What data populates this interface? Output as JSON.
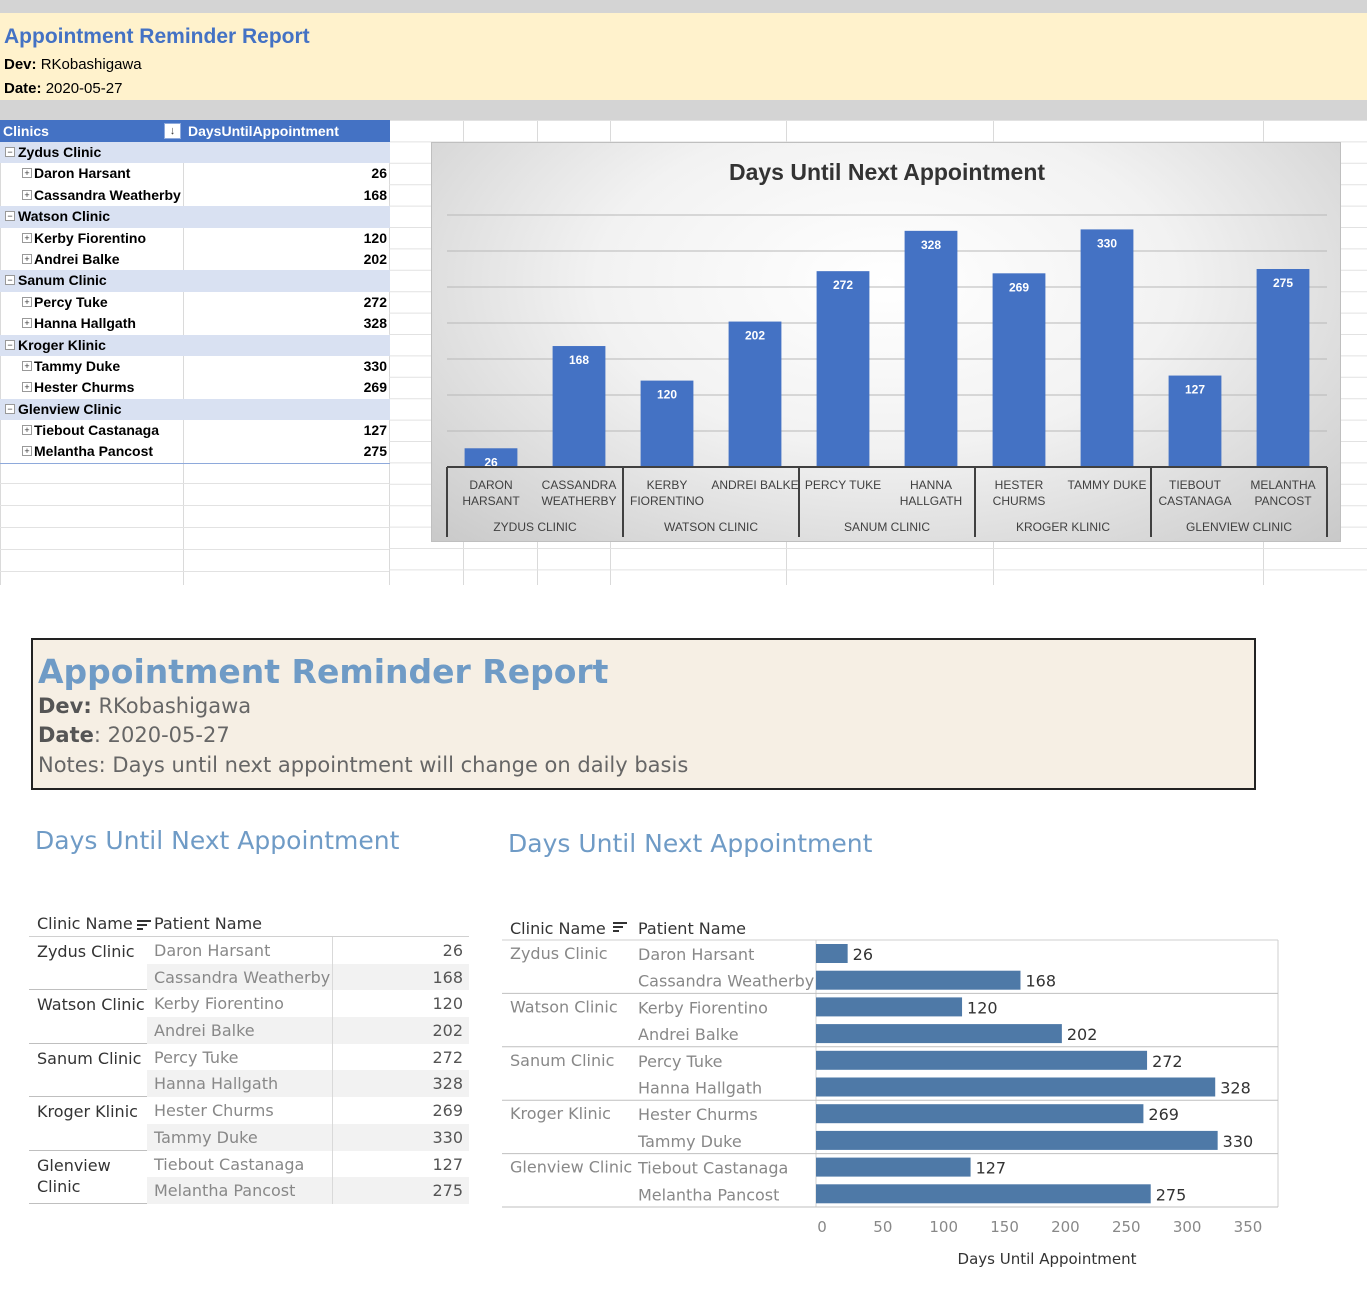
{
  "excel": {
    "title": "Appointment Reminder Report",
    "dev_label": "Dev:",
    "dev_value": "RKobashigawa",
    "date_label": "Date:",
    "date_value": "2020-05-27",
    "pivot": {
      "col1": "Clinics",
      "col2": "DaysUntilAppointment",
      "sort_icon": "sort-descending-icon",
      "groups": [
        {
          "clinic": "Zydus Clinic",
          "rows": [
            {
              "name": "Daron Harsant",
              "value": 26
            },
            {
              "name": "Cassandra Weatherby",
              "value": 168
            }
          ]
        },
        {
          "clinic": "Watson Clinic",
          "rows": [
            {
              "name": "Kerby Fiorentino",
              "value": 120
            },
            {
              "name": "Andrei Balke",
              "value": 202
            }
          ]
        },
        {
          "clinic": "Sanum Clinic",
          "rows": [
            {
              "name": "Percy Tuke",
              "value": 272
            },
            {
              "name": "Hanna Hallgath",
              "value": 328
            }
          ]
        },
        {
          "clinic": "Kroger Klinic",
          "rows": [
            {
              "name": "Tammy Duke",
              "value": 330
            },
            {
              "name": "Hester Churms",
              "value": 269
            }
          ]
        },
        {
          "clinic": "Glenview Clinic",
          "rows": [
            {
              "name": "Tiebout Castanaga",
              "value": 127
            },
            {
              "name": "Melantha Pancost",
              "value": 275
            }
          ]
        }
      ]
    }
  },
  "tableau": {
    "title": "Appointment Reminder Report",
    "dev_label": "Dev:",
    "dev_value": "RKobashigawa",
    "date_label": "Date",
    "date_value": ": 2020-05-27",
    "notes": "Notes: Days until next appointment will change on daily basis",
    "table_title": "Days Until Next Appointment",
    "chart_title": "Days Until Next Appointment",
    "col_clinic": "Clinic Name",
    "col_patient": "Patient Name",
    "groups": [
      {
        "clinic": "Zydus Clinic",
        "rows": [
          {
            "name": "Daron Harsant",
            "value": "26"
          },
          {
            "name": "Cassandra Weatherby",
            "value": "168"
          }
        ]
      },
      {
        "clinic": "Watson Clinic",
        "rows": [
          {
            "name": "Kerby Fiorentino",
            "value": "120"
          },
          {
            "name": "Andrei Balke",
            "value": "202"
          }
        ]
      },
      {
        "clinic": "Sanum Clinic",
        "rows": [
          {
            "name": "Percy Tuke",
            "value": "272"
          },
          {
            "name": "Hanna Hallgath",
            "value": "328"
          }
        ]
      },
      {
        "clinic": "Kroger Klinic",
        "rows": [
          {
            "name": "Hester Churms",
            "value": "269"
          },
          {
            "name": "Tammy Duke",
            "value": "330"
          }
        ]
      },
      {
        "clinic": "Glenview Clinic",
        "rows": [
          {
            "name": "Tiebout Castanaga",
            "value": "127"
          },
          {
            "name": "Melantha Pancost",
            "value": "275"
          }
        ]
      }
    ]
  },
  "chart_data": [
    {
      "type": "bar",
      "title": "Days Until Next Appointment",
      "categories": [
        "DARON HARSANT",
        "CASSANDRA WEATHERBY",
        "KERBY FIORENTINO",
        "ANDREI BALKE",
        "PERCY TUKE",
        "HANNA HALLGATH",
        "HESTER CHURMS",
        "TAMMY DUKE",
        "TIEBOUT CASTANAGA",
        "MELANTHA PANCOST"
      ],
      "groups": [
        "ZYDUS CLINIC",
        "WATSON CLINIC",
        "SANUM CLINIC",
        "KROGER KLINIC",
        "GLENVIEW CLINIC"
      ],
      "values": [
        26,
        168,
        120,
        202,
        272,
        328,
        269,
        330,
        127,
        275
      ],
      "ylim": [
        0,
        350
      ],
      "grid": true,
      "data_labels": true,
      "color": "#4472c4"
    },
    {
      "type": "bar",
      "orientation": "horizontal",
      "title": "Days Until Next Appointment",
      "xlabel": "Days Until Appointment",
      "groups": [
        "Zydus Clinic",
        "Watson Clinic",
        "Sanum Clinic",
        "Kroger Klinic",
        "Glenview Clinic"
      ],
      "categories": [
        "Daron Harsant",
        "Cassandra Weatherby",
        "Kerby Fiorentino",
        "Andrei Balke",
        "Percy Tuke",
        "Hanna Hallgath",
        "Hester Churms",
        "Tammy Duke",
        "Tiebout Castanaga",
        "Melantha Pancost"
      ],
      "values": [
        26,
        168,
        120,
        202,
        272,
        328,
        269,
        330,
        127,
        275
      ],
      "xlim": [
        0,
        350
      ],
      "xticks": [
        0,
        50,
        100,
        150,
        200,
        250,
        300,
        350
      ],
      "data_labels": true,
      "color": "#4e79a7"
    }
  ]
}
